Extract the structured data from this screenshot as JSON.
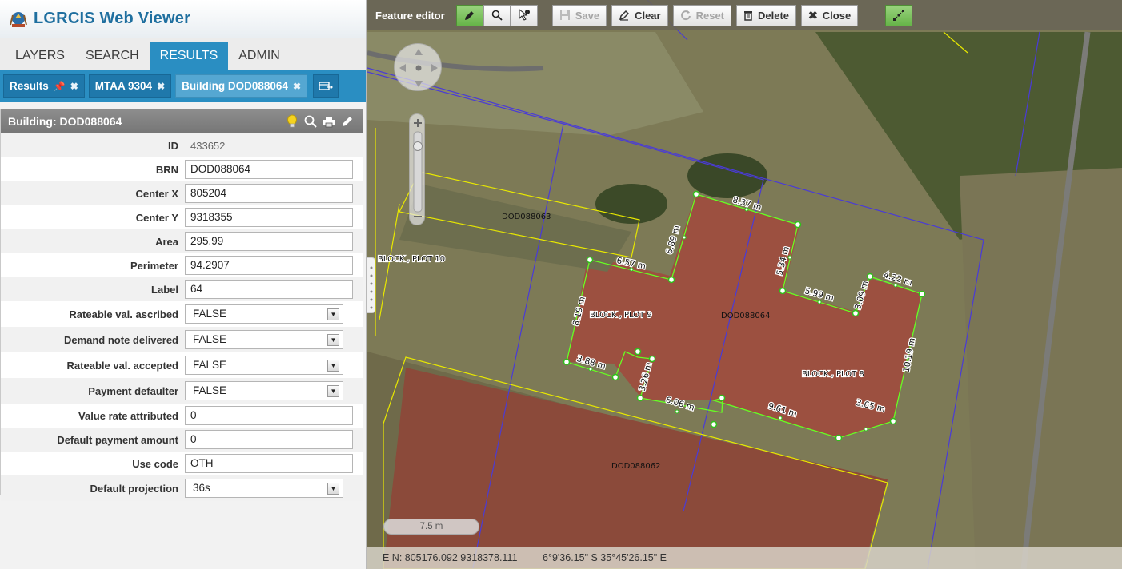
{
  "app": {
    "title": "LGRCIS Web Viewer"
  },
  "main_tabs": [
    {
      "label": "LAYERS",
      "active": false
    },
    {
      "label": "SEARCH",
      "active": false
    },
    {
      "label": "RESULTS",
      "active": true
    },
    {
      "label": "ADMIN",
      "active": false
    }
  ],
  "result_tabs": [
    {
      "label": "Results",
      "pinned": true
    },
    {
      "label": "MTAA 9304",
      "pinned": false
    },
    {
      "label": "Building DOD088064",
      "pinned": false,
      "active": true
    }
  ],
  "panel": {
    "title": "Building: DOD088064",
    "fields": {
      "id": {
        "label": "ID",
        "value": "433652"
      },
      "brn": {
        "label": "BRN",
        "value": "DOD088064"
      },
      "center_x": {
        "label": "Center X",
        "value": "805204"
      },
      "center_y": {
        "label": "Center Y",
        "value": "9318355"
      },
      "area": {
        "label": "Area",
        "value": "295.99"
      },
      "perimeter": {
        "label": "Perimeter",
        "value": "94.2907"
      },
      "label": {
        "label": "Label",
        "value": "64"
      },
      "rateable_ascribed": {
        "label": "Rateable val. ascribed",
        "value": "FALSE"
      },
      "demand_note": {
        "label": "Demand note delivered",
        "value": "FALSE"
      },
      "rateable_accepted": {
        "label": "Rateable val. accepted",
        "value": "FALSE"
      },
      "payment_defaulter": {
        "label": "Payment defaulter",
        "value": "FALSE"
      },
      "value_rate": {
        "label": "Value rate attributed",
        "value": "0"
      },
      "default_payment": {
        "label": "Default payment amount",
        "value": "0"
      },
      "use_code": {
        "label": "Use code",
        "value": "OTH"
      },
      "default_projection": {
        "label": "Default projection",
        "value": "36s"
      }
    }
  },
  "toolbar": {
    "title": "Feature editor",
    "save": "Save",
    "clear": "Clear",
    "reset": "Reset",
    "delete": "Delete",
    "close": "Close"
  },
  "map": {
    "labels": {
      "dod063": "DOD088063",
      "dod064": "DOD088064",
      "dod062": "DOD088062",
      "plot10": "BLOCK , PLOT 10",
      "plot9": "BLOCK , PLOT 9",
      "plot8": "BLOCK , PLOT 8"
    },
    "dimensions": {
      "d1": "8.37 m",
      "d2": "6.89 m",
      "d3": "5.34 m",
      "d4": "6.57 m",
      "d5": "5.99 m",
      "d6": "3.09 m",
      "d7": "4.22 m",
      "d8": "8.19 m",
      "d9": "10.19 m",
      "d10": "3.88 m",
      "d11": "3.26 m",
      "d12": "6.06 m",
      "d13": "9.61 m",
      "d14": "3.65 m"
    },
    "scale": "7.5 m",
    "coords_en": "E N: 805176.092 9318378.111",
    "coords_geo": "6°9'36.15\" S 35°45'26.15\" E"
  },
  "colors": {
    "accent": "#2a8ec2",
    "title": "#1f6f9f",
    "parcel_yellow": "#e8e800",
    "boundary_blue": "#4a3bd6",
    "edit_green": "#66ff22"
  }
}
